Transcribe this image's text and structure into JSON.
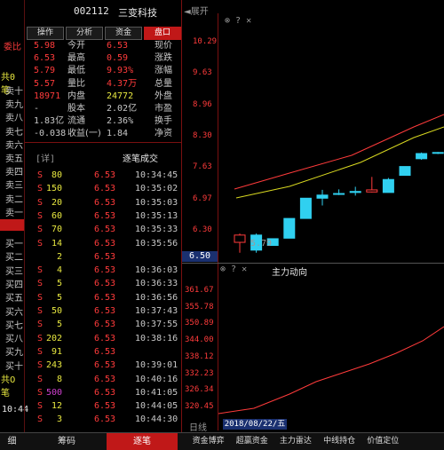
{
  "header": {
    "code": "002112",
    "name": "三变科技"
  },
  "tabs": [
    {
      "label": "盘口",
      "active": true
    },
    {
      "label": "资金",
      "active": false
    },
    {
      "label": "分析",
      "active": false
    },
    {
      "label": "操作",
      "active": false
    }
  ],
  "left_strip": {
    "top_labels": [
      "委比",
      "",
      "共0笔",
      "卖十",
      "卖九",
      "卖八",
      "卖七",
      "卖六",
      "卖五",
      "卖四",
      "卖三",
      "卖二",
      "卖一"
    ],
    "bottom_labels": [
      "买一",
      "买二",
      "买三",
      "买四",
      "买五",
      "买六",
      "买七",
      "买八",
      "买九",
      "买十",
      "共0笔"
    ],
    "time": "10:44"
  },
  "quote": [
    {
      "l1": "现价",
      "v1": "6.53",
      "l2": "今开",
      "v2": "5.98"
    },
    {
      "l1": "涨跌",
      "v1": "0.59",
      "l2": "最高",
      "v2": "6.53"
    },
    {
      "l1": "涨幅",
      "v1": "9.93%",
      "l2": "最低",
      "v2": "5.79"
    },
    {
      "l1": "总量",
      "v1": "4.37万",
      "l2": "量比",
      "v2": "5.57"
    },
    {
      "l1": "外盘",
      "v1": "24772",
      "l2": "内盘",
      "v2": "18971"
    },
    {
      "l1": "市盈",
      "v1": "2.02亿",
      "l2": "股本",
      "v2": "-"
    },
    {
      "l1": "换手",
      "v1": "2.36%",
      "l2": "流通",
      "v2": "1.83亿"
    },
    {
      "l1": "净资",
      "v1": "1.84",
      "l2": "收益(一)",
      "v2": "-0.038"
    }
  ],
  "ticks_header": {
    "title": "逐笔成交",
    "more": "[详]"
  },
  "ticks": [
    {
      "time": "10:34:45",
      "price": "6.53",
      "vol": "80",
      "dir": "S"
    },
    {
      "time": "10:35:02",
      "price": "6.53",
      "vol": "150",
      "dir": "S"
    },
    {
      "time": "10:35:03",
      "price": "6.53",
      "vol": "20",
      "dir": "S"
    },
    {
      "time": "10:35:13",
      "price": "6.53",
      "vol": "60",
      "dir": "S"
    },
    {
      "time": "10:35:33",
      "price": "6.53",
      "vol": "70",
      "dir": "S"
    },
    {
      "time": "10:35:56",
      "price": "6.53",
      "vol": "14",
      "dir": "S"
    },
    {
      "time": "",
      "price": "6.53",
      "vol": "2",
      "dir": ""
    },
    {
      "time": "10:36:03",
      "price": "6.53",
      "vol": "4",
      "dir": "S"
    },
    {
      "time": "10:36:33",
      "price": "6.53",
      "vol": "5",
      "dir": "S"
    },
    {
      "time": "10:36:56",
      "price": "6.53",
      "vol": "5",
      "dir": "S"
    },
    {
      "time": "10:37:43",
      "price": "6.53",
      "vol": "50",
      "dir": "S"
    },
    {
      "time": "10:37:55",
      "price": "6.53",
      "vol": "5",
      "dir": "S"
    },
    {
      "time": "10:38:16",
      "price": "6.53",
      "vol": "202",
      "dir": "S"
    },
    {
      "time": "",
      "price": "6.53",
      "vol": "91",
      "dir": "S"
    },
    {
      "time": "10:39:01",
      "price": "6.53",
      "vol": "243",
      "dir": "S"
    },
    {
      "time": "10:40:16",
      "price": "6.53",
      "vol": "8",
      "dir": "S"
    },
    {
      "time": "10:41:05",
      "price": "6.53",
      "vol": "500",
      "dir": "S"
    },
    {
      "time": "10:44:05",
      "price": "6.53",
      "vol": "12",
      "dir": "S"
    },
    {
      "time": "10:44:30",
      "price": "6.53",
      "vol": "3",
      "dir": "S"
    }
  ],
  "chart_top": {
    "panel_label": "◄展开",
    "icons_text": "⊗ ? ✕",
    "price_ticks": [
      "10.29",
      "9.63",
      "8.96",
      "8.30",
      "7.63",
      "6.97",
      "6.30"
    ],
    "low_label": "5.79",
    "current_label": "6.50",
    "chart_data": {
      "type": "candlestick",
      "ohlc": [
        {
          "o": 5.99,
          "h": 6.16,
          "l": 5.79,
          "c": 6.13,
          "color": "red"
        },
        {
          "o": 6.13,
          "h": 6.16,
          "l": 5.79,
          "c": 5.84,
          "color": "cyan"
        },
        {
          "o": 5.93,
          "h": 6.06,
          "l": 5.93,
          "c": 6.06,
          "color": "cyan"
        },
        {
          "o": 6.07,
          "h": 6.45,
          "l": 6.07,
          "c": 6.45,
          "color": "cyan"
        },
        {
          "o": 6.45,
          "h": 6.84,
          "l": 6.45,
          "c": 6.84,
          "color": "cyan"
        },
        {
          "o": 6.84,
          "h": 7.0,
          "l": 6.7,
          "c": 6.9,
          "color": "cyan"
        },
        {
          "o": 6.92,
          "h": 7.01,
          "l": 6.9,
          "c": 6.93,
          "color": "cyan"
        },
        {
          "o": 6.95,
          "h": 7.06,
          "l": 6.89,
          "c": 6.97,
          "color": "cyan"
        },
        {
          "o": 7.0,
          "h": 7.25,
          "l": 6.95,
          "c": 6.96,
          "color": "red"
        },
        {
          "o": 6.95,
          "h": 7.23,
          "l": 6.95,
          "c": 7.2,
          "color": "cyan"
        },
        {
          "o": 7.28,
          "h": 7.45,
          "l": 7.28,
          "c": 7.45,
          "color": "cyan"
        },
        {
          "o": 7.6,
          "h": 7.72,
          "l": 7.58,
          "c": 7.7,
          "color": "cyan"
        },
        {
          "o": 7.71,
          "h": 7.73,
          "l": 7.69,
          "c": 7.72,
          "color": "cyan"
        },
        {
          "o": 7.63,
          "h": 7.76,
          "l": 7.63,
          "c": 7.7,
          "color": "red"
        }
      ]
    }
  },
  "chart_bottom": {
    "title": "主力动向",
    "icons_text": "⊗ ? ✕",
    "value_ticks": [
      "361.67",
      "355.78",
      "350.89",
      "344.00",
      "338.12",
      "332.23",
      "326.34",
      "320.45"
    ],
    "footer_date": "2018/08/22/五",
    "footer_left": "日线"
  },
  "bottom_tabs_left": [
    "细",
    "筹码",
    "逐笔"
  ],
  "bottom_tabs_right": [
    "资金博弈",
    "超赢资金",
    "主力雷达",
    "中线持仓",
    "价值定位"
  ],
  "accent": {
    "red": "#ff3b3b",
    "green": "#38d838",
    "yellow": "#e8e840",
    "cyan": "#40c8e8"
  }
}
